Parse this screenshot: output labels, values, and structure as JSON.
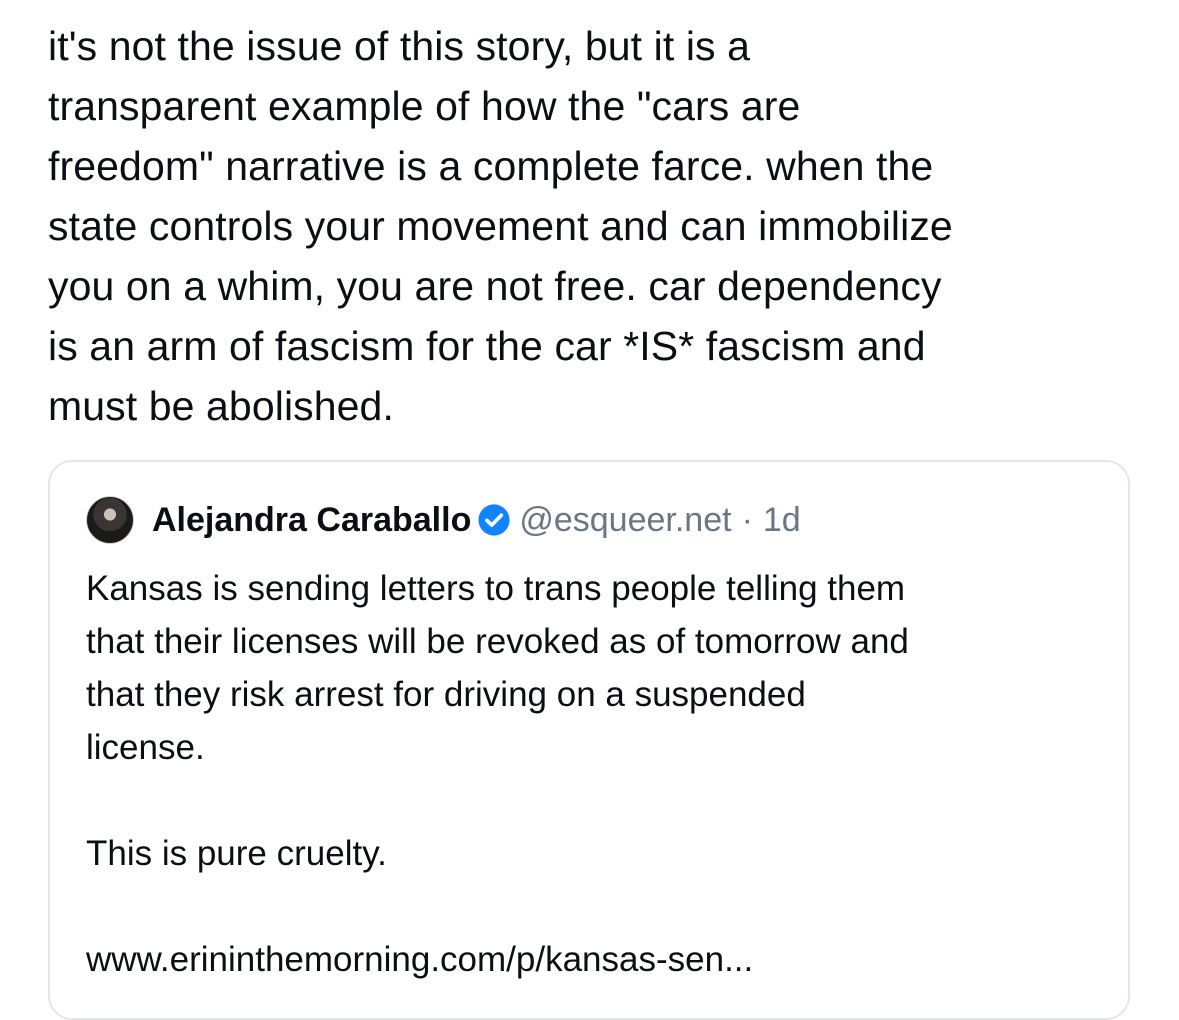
{
  "post": {
    "text": "it's not the issue of this story, but it is a\ntransparent example of how the \"cars are\nfreedom\" narrative is a complete farce. when the\nstate controls your movement and can immobilize\nyou on a whim, you are not free. car dependency\nis an arm of fascism for the car *IS* fascism and\nmust be abolished."
  },
  "quote": {
    "author_name": "Alejandra Caraballo",
    "verified_icon": "verified-badge-icon",
    "handle": "@esqueer.net",
    "separator": "·",
    "age": "1d",
    "text": "Kansas is sending letters to trans people telling them\nthat their licenses will be revoked as of tomorrow and\nthat they risk arrest for driving on a suspended\nlicense.\n\nThis is pure cruelty.\n\nwww.erininthemorning.com/p/kansas-sen..."
  },
  "colors": {
    "text": "#0b0f14",
    "muted": "#6b7684",
    "verified": "#1083fe",
    "card_border": "#e3e7ec"
  }
}
